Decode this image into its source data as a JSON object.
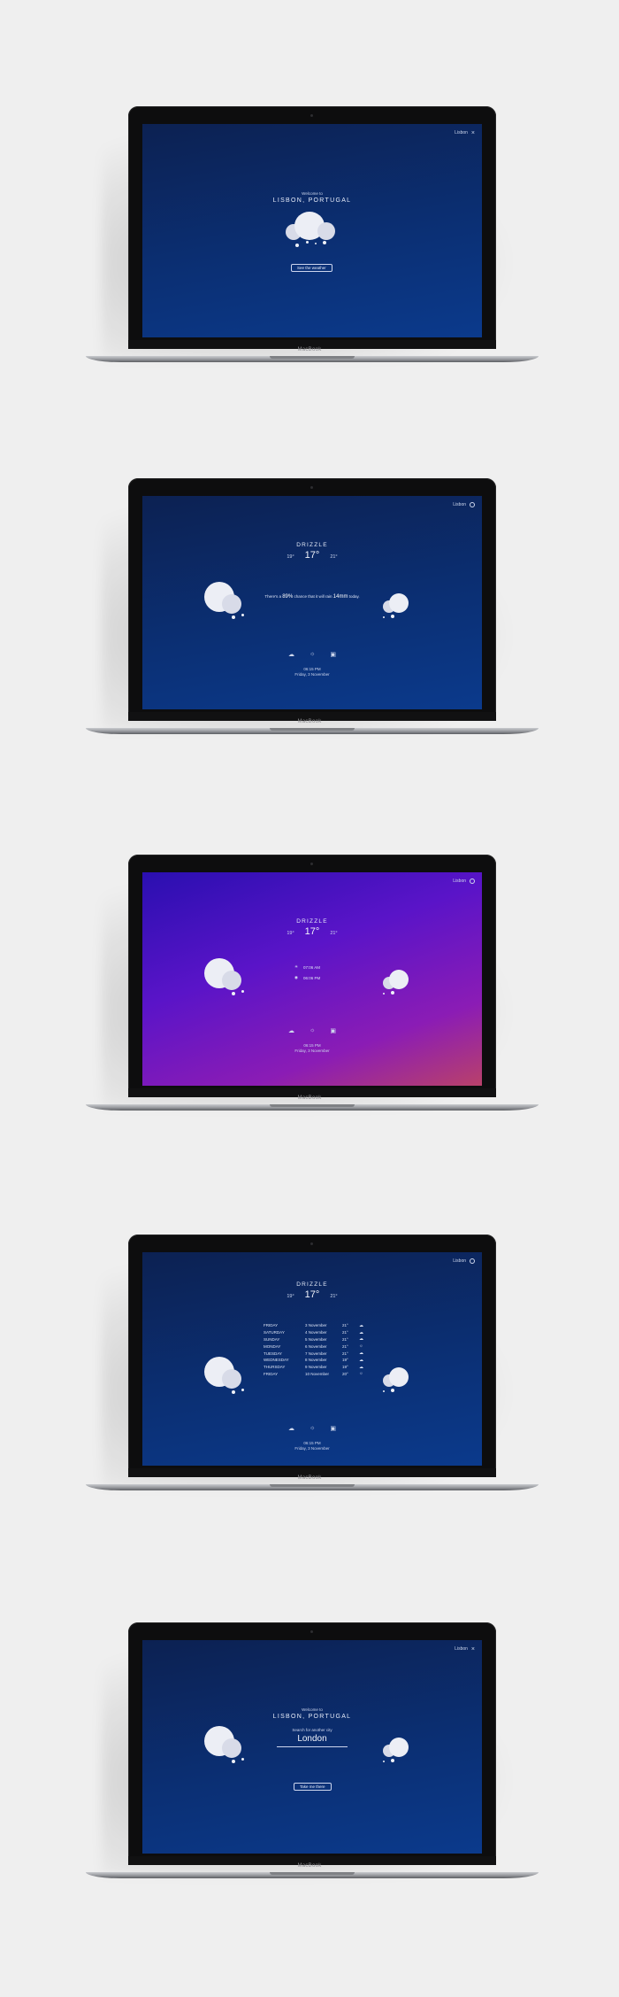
{
  "brand": "MacBook",
  "screens": [
    {
      "city_top": "Lisbon",
      "welcome": "Welcome to",
      "city": "LISBON, PORTUGAL",
      "button": "See the weather"
    },
    {
      "city_top": "Lisbon",
      "condition": "DRIZZLE",
      "temp_min": "19°",
      "temp_now": "17°",
      "temp_max": "21°",
      "message_pre": "There's a",
      "chance": "89%",
      "message_mid": "chance that it will rain",
      "amount": "14mm",
      "message_post": "today.",
      "time": "06:15 PM",
      "date": "Friday, 3 November"
    },
    {
      "city_top": "Lisbon",
      "condition": "DRIZZLE",
      "temp_min": "19°",
      "temp_now": "17°",
      "temp_max": "21°",
      "sunrise": "07:06 AM",
      "sunset": "06:06 PM",
      "time": "06:15 PM",
      "date": "Friday, 3 November"
    },
    {
      "city_top": "Lisbon",
      "condition": "DRIZZLE",
      "temp_min": "19°",
      "temp_now": "17°",
      "temp_max": "21°",
      "forecast": [
        {
          "day": "FRIDAY",
          "date": "3 November",
          "temp": "21°"
        },
        {
          "day": "SATURDAY",
          "date": "4 November",
          "temp": "21°"
        },
        {
          "day": "SUNDAY",
          "date": "5 November",
          "temp": "21°"
        },
        {
          "day": "MONDAY",
          "date": "6 November",
          "temp": "21°"
        },
        {
          "day": "TUESDAY",
          "date": "7 November",
          "temp": "21°"
        },
        {
          "day": "WEDNESDAY",
          "date": "8 November",
          "temp": "19°"
        },
        {
          "day": "THURSDAY",
          "date": "9 November",
          "temp": "19°"
        },
        {
          "day": "FRIDAY",
          "date": "10 November",
          "temp": "20°"
        }
      ],
      "time": "06:15 PM",
      "date": "Friday, 3 November"
    },
    {
      "city_top": "Lisbon",
      "welcome": "Welcome to",
      "city": "LISBON, PORTUGAL",
      "search_label": "Search for another city",
      "search_value": "London",
      "button": "Take me there"
    }
  ],
  "colors": {
    "blue_top": "#0c2152",
    "blue_bottom": "#0b3a8c",
    "purple_top": "#2a0fb0",
    "purple_bottom": "#b9416a",
    "cloud": "#d8dbe8"
  },
  "icons": [
    "close-icon",
    "gear-icon",
    "cloud-icon",
    "sun-icon",
    "calendar-icon",
    "sunrise-icon",
    "sunset-icon"
  ]
}
